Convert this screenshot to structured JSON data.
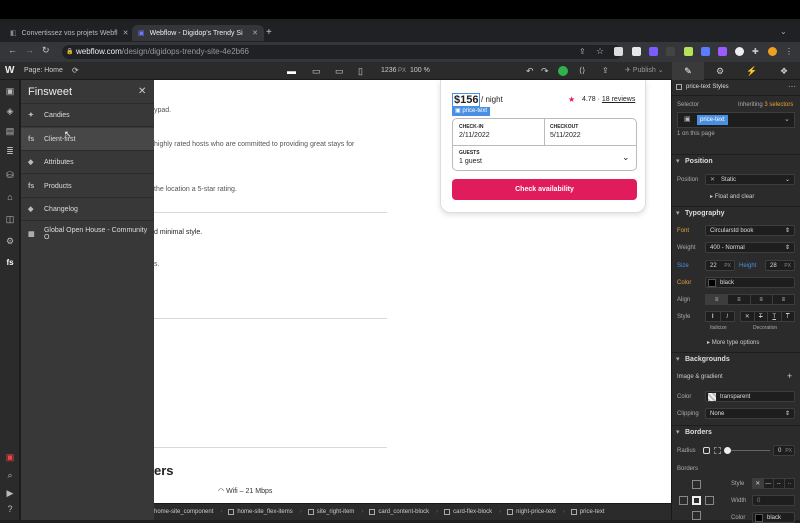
{
  "browser": {
    "tabs": [
      {
        "title": "Convertissez vos projets Webfl",
        "active": false
      },
      {
        "title": "Webflow - Digidop's Trendy Si",
        "active": true
      }
    ],
    "url_host": "webflow.com",
    "url_path": "/design/digidops-trendy-site-4e2b66"
  },
  "webflow_top": {
    "page_label": "Page: Home",
    "width_value": "1236",
    "width_unit": "PX",
    "zoom": "100 %",
    "publish_label": "Publish"
  },
  "finsweet": {
    "title": "Finsweet",
    "items": [
      {
        "label": "Candies",
        "icon": "candy-icon"
      },
      {
        "label": "Client-first",
        "icon": "fs-icon"
      },
      {
        "label": "Attributes",
        "icon": "tag-icon"
      },
      {
        "label": "Products",
        "icon": "fs-icon"
      },
      {
        "label": "Changelog",
        "icon": "tag-icon"
      },
      {
        "label": "Global Open House - Community O",
        "icon": "grid-icon"
      }
    ]
  },
  "canvas": {
    "text_1": "ypad.",
    "text_2": "highly rated hosts who are committed to providing great stays for",
    "text_3": "the location a 5-star rating.",
    "text_4": "d minimal style.",
    "text_5": "s.",
    "heading_fragment": "ers",
    "wifi_label": "Wifi – 21 Mbps"
  },
  "booking": {
    "price": "$156",
    "per": "/ night",
    "selected_tag": "price-text",
    "rating": "4.78",
    "reviews": "18 reviews",
    "checkin_label": "CHECK-IN",
    "checkin_value": "2/11/2022",
    "checkout_label": "CHECKOUT",
    "checkout_value": "5/11/2022",
    "guests_label": "GUESTS",
    "guests_value": "1 guest",
    "button": "Check availability"
  },
  "breadcrumbs": [
    "home-site_component",
    "home-site_flex-items",
    "site_right-item",
    "card_content-block",
    "card-flex-block",
    "night-price-text",
    "price-text"
  ],
  "right_panel": {
    "styles_title": "price-text Styles",
    "selector_label": "Selector",
    "inheriting": "Inheriting",
    "inheriting_count": "3 selectors",
    "selector_chip": "price-text",
    "on_page": "1 on this page",
    "position_header": "Position",
    "position_label": "Position",
    "position_value": "Static",
    "float_clear": "Float and clear",
    "typography_header": "Typography",
    "font_label": "Font",
    "font_value": "Circularstd book",
    "weight_label": "Weight",
    "weight_value": "400 - Normal",
    "size_label": "Size",
    "size_value": "22",
    "size_unit": "PX",
    "height_label": "Height",
    "height_value": "28",
    "height_unit": "PX",
    "color_label": "Color",
    "color_value": "black",
    "align_label": "Align",
    "style_label": "Style",
    "italicize_label": "Italicize",
    "decoration_label": "Decoration",
    "more_type": "More type options",
    "backgrounds_header": "Backgrounds",
    "image_gradient": "Image & gradient",
    "bg_color_label": "Color",
    "bg_color_value": "transparent",
    "clipping_label": "Clipping",
    "clipping_value": "None",
    "borders_header": "Borders",
    "radius_label": "Radius",
    "radius_value": "0",
    "radius_unit": "PX",
    "borders_label": "Borders",
    "border_style_label": "Style",
    "border_width_label": "Width",
    "border_width_value": "0",
    "border_color_label": "Color",
    "border_color_value": "black"
  },
  "colors": {
    "accent_pink": "#e11c5c",
    "selection_blue": "#4a90e2",
    "panel_dark": "#2b2b2b",
    "finsweet_panel": "#383838"
  }
}
